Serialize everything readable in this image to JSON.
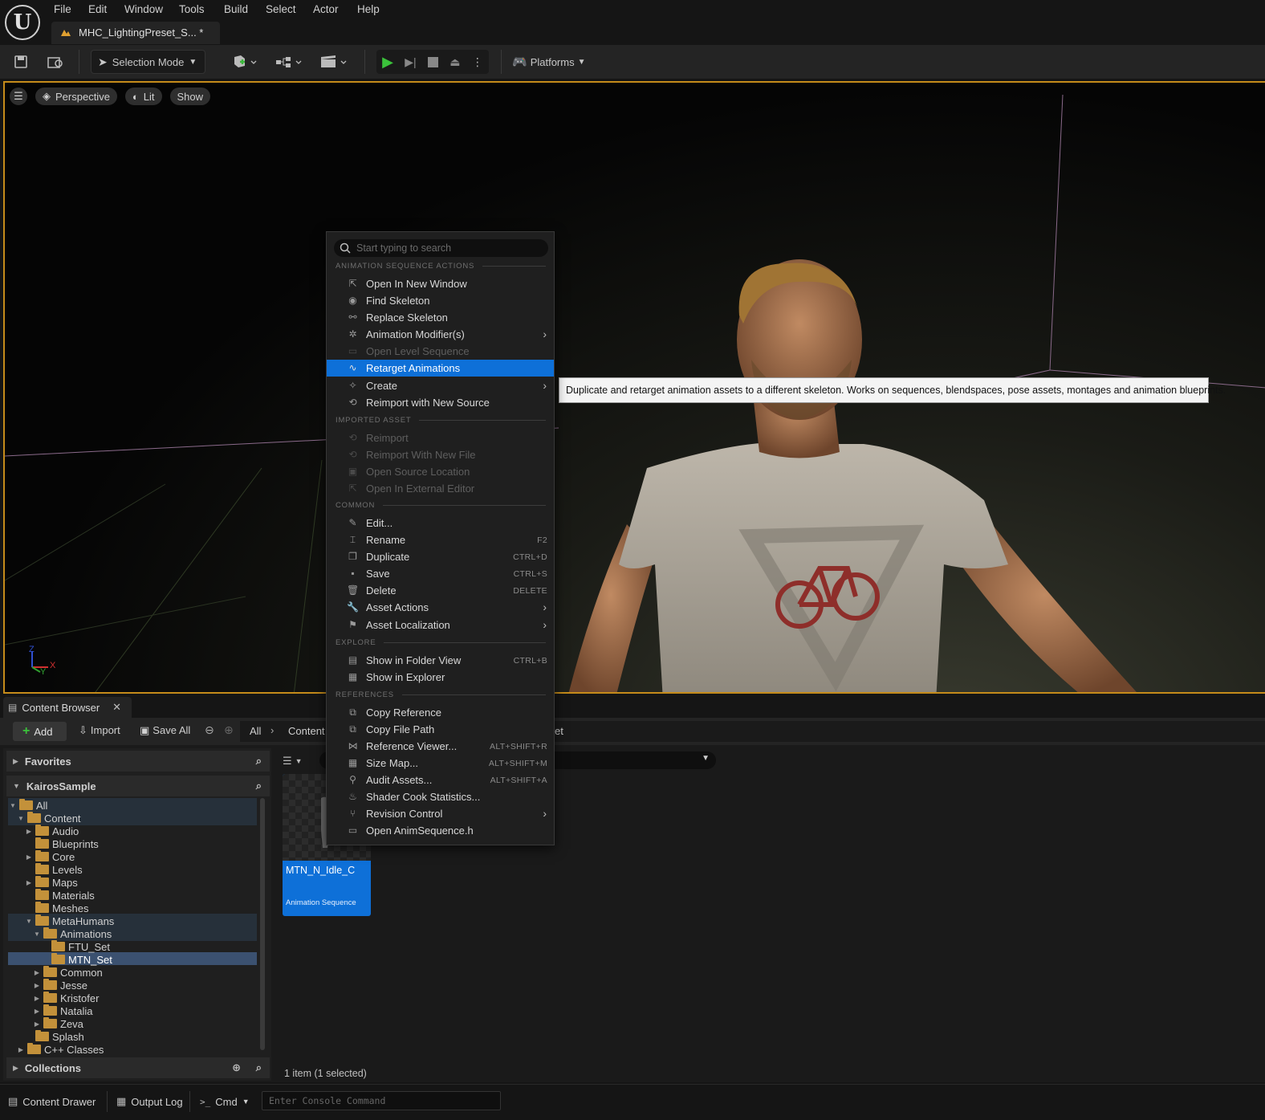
{
  "app": {
    "menu": [
      "File",
      "Edit",
      "Window",
      "Tools",
      "Build",
      "Select",
      "Actor",
      "Help"
    ],
    "document_tab": "MHC_LightingPreset_S... *"
  },
  "toolbar": {
    "selection_mode": "Selection Mode",
    "platforms": "Platforms"
  },
  "viewport": {
    "perspective": "Perspective",
    "lit": "Lit",
    "show": "Show",
    "axis_x": "X",
    "axis_y": "Y",
    "axis_z": "Z"
  },
  "context_menu": {
    "search_placeholder": "Start typing to search",
    "sections": {
      "animation": "ANIMATION SEQUENCE ACTIONS",
      "imported": "IMPORTED ASSET",
      "common": "COMMON",
      "explore": "EXPLORE",
      "references": "REFERENCES"
    },
    "items": {
      "open_new_window": "Open In New Window",
      "find_skeleton": "Find Skeleton",
      "replace_skeleton": "Replace Skeleton",
      "animation_modifiers": "Animation Modifier(s)",
      "open_level_sequence": "Open Level Sequence",
      "retarget_animations": "Retarget Animations",
      "create": "Create",
      "reimport_new_source": "Reimport with New Source",
      "reimport": "Reimport",
      "reimport_new_file": "Reimport With New File",
      "open_source_location": "Open Source Location",
      "open_external_editor": "Open In External Editor",
      "edit": "Edit...",
      "rename": "Rename",
      "rename_sc": "F2",
      "duplicate": "Duplicate",
      "duplicate_sc": "CTRL+D",
      "save": "Save",
      "save_sc": "CTRL+S",
      "delete": "Delete",
      "delete_sc": "DELETE",
      "asset_actions": "Asset Actions",
      "asset_localization": "Asset Localization",
      "show_folder_view": "Show in Folder View",
      "show_folder_view_sc": "CTRL+B",
      "show_explorer": "Show in Explorer",
      "copy_reference": "Copy Reference",
      "copy_file_path": "Copy File Path",
      "reference_viewer": "Reference Viewer...",
      "reference_viewer_sc": "ALT+SHIFT+R",
      "size_map": "Size Map...",
      "size_map_sc": "ALT+SHIFT+M",
      "audit_assets": "Audit Assets...",
      "audit_assets_sc": "ALT+SHIFT+A",
      "shader_cook": "Shader Cook Statistics...",
      "revision_control": "Revision Control",
      "open_header": "Open AnimSequence.h"
    }
  },
  "tooltip": "Duplicate and retarget animation assets to a different skeleton. Works on sequences, blendspaces, pose assets, montages and animation blueprints.",
  "content_browser": {
    "tab": "Content Browser",
    "add": "Add",
    "import": "Import",
    "save_all": "Save All",
    "breadcrumb_all": "All",
    "breadcrumb_content": "Content",
    "breadcrumb_tail": "et",
    "favorites": "Favorites",
    "project": "KairosSample",
    "collections": "Collections",
    "tree": {
      "all": "All",
      "content": "Content",
      "audio": "Audio",
      "blueprints": "Blueprints",
      "core": "Core",
      "levels": "Levels",
      "maps": "Maps",
      "materials": "Materials",
      "meshes": "Meshes",
      "metahumans": "MetaHumans",
      "animations": "Animations",
      "ftu_set": "FTU_Set",
      "mtn_set": "MTN_Set",
      "common": "Common",
      "jesse": "Jesse",
      "kristofer": "Kristofer",
      "natalia": "Natalia",
      "zeva": "Zeva",
      "splash": "Splash",
      "cpp_classes": "C++ Classes"
    },
    "asset_name": "MTN_N_Idle_C",
    "asset_type": "Animation Sequence",
    "status": "1 item (1 selected)"
  },
  "bottom_bar": {
    "content_drawer": "Content Drawer",
    "output_log": "Output Log",
    "cmd": "Cmd",
    "console_placeholder": "Enter Console Command"
  }
}
